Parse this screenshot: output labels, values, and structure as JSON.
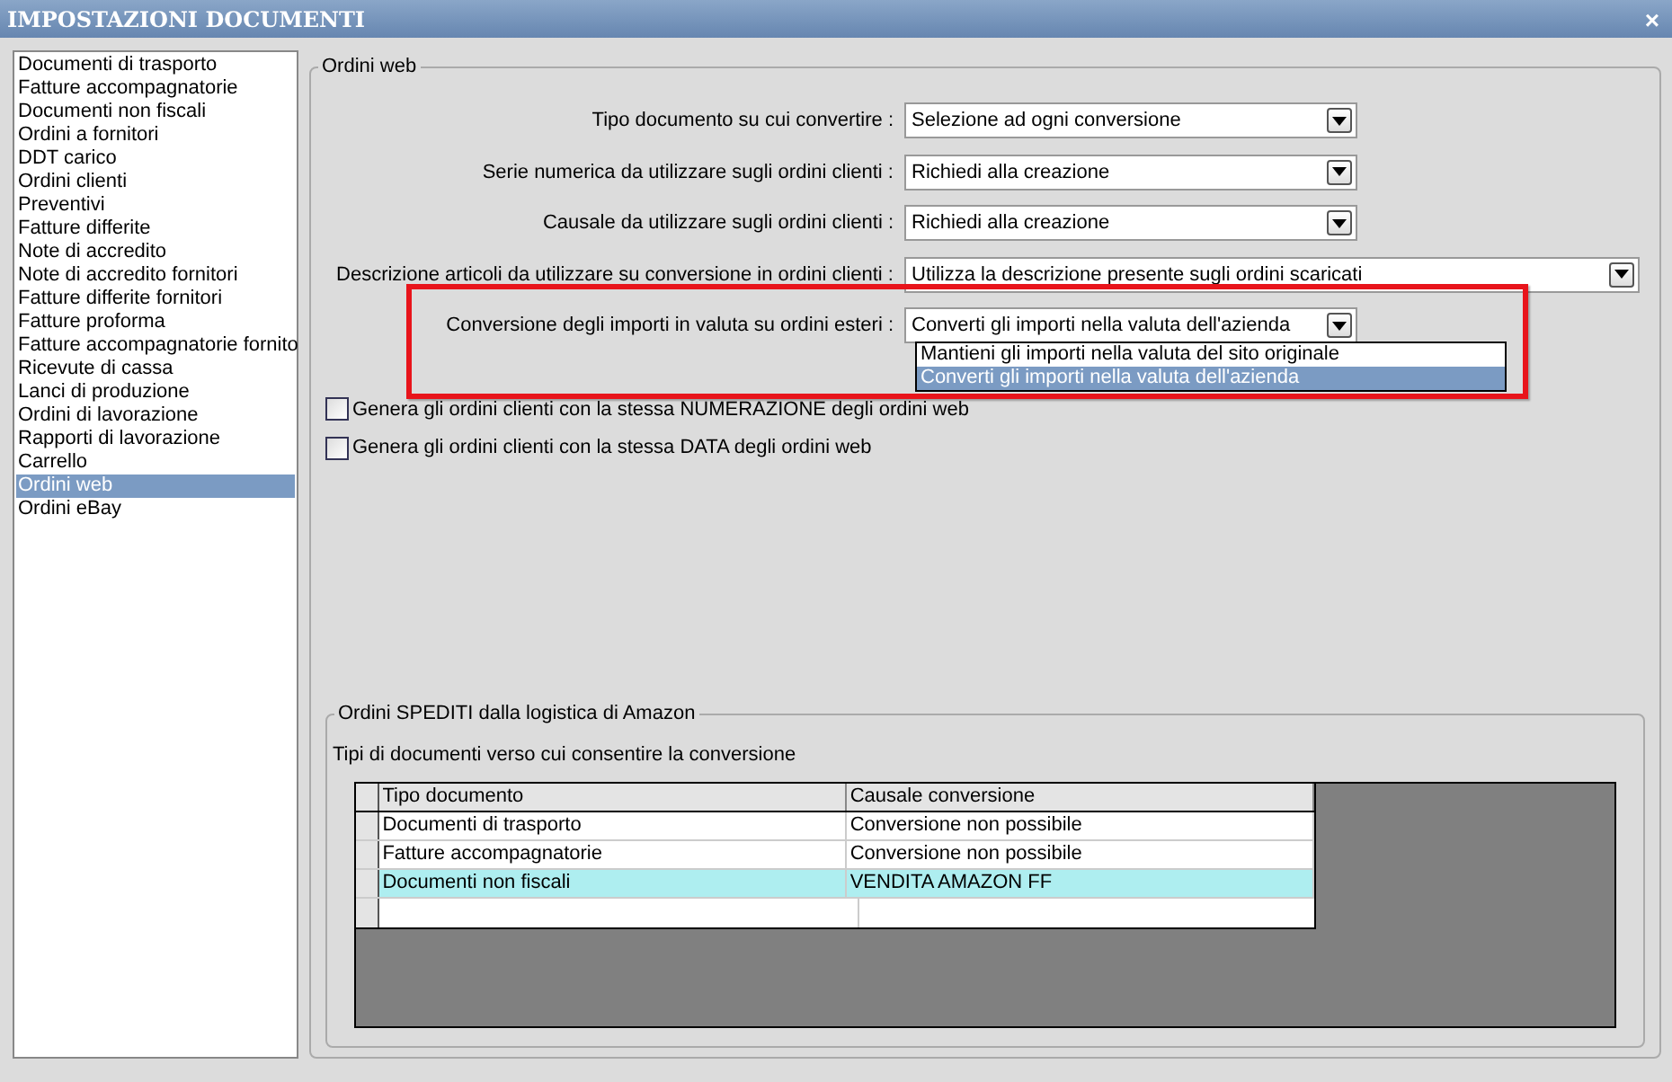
{
  "window": {
    "title": "IMPOSTAZIONI DOCUMENTI",
    "close": "×"
  },
  "sidebar": {
    "items": [
      {
        "label": "Documenti di trasporto",
        "selected": false
      },
      {
        "label": "Fatture accompagnatorie",
        "selected": false
      },
      {
        "label": "Documenti non fiscali",
        "selected": false
      },
      {
        "label": "Ordini a fornitori",
        "selected": false
      },
      {
        "label": "DDT carico",
        "selected": false
      },
      {
        "label": "Ordini clienti",
        "selected": false
      },
      {
        "label": "Preventivi",
        "selected": false
      },
      {
        "label": "Fatture differite",
        "selected": false
      },
      {
        "label": "Note di accredito",
        "selected": false
      },
      {
        "label": "Note di accredito fornitori",
        "selected": false
      },
      {
        "label": "Fatture differite fornitori",
        "selected": false
      },
      {
        "label": "Fatture proforma",
        "selected": false
      },
      {
        "label": "Fatture accompagnatorie fornito",
        "selected": false
      },
      {
        "label": "Ricevute di cassa",
        "selected": false
      },
      {
        "label": "Lanci di produzione",
        "selected": false
      },
      {
        "label": "Ordini di lavorazione",
        "selected": false
      },
      {
        "label": "Rapporti di lavorazione",
        "selected": false
      },
      {
        "label": "Carrello",
        "selected": false
      },
      {
        "label": "Ordini web",
        "selected": true
      },
      {
        "label": "Ordini eBay",
        "selected": false
      }
    ]
  },
  "ordini_web": {
    "title": "Ordini web",
    "fields": [
      {
        "label": "Tipo documento su cui convertire :",
        "value": "Selezione ad ogni conversione",
        "wide": false
      },
      {
        "label": "Serie numerica da utilizzare sugli ordini clienti :",
        "value": "Richiedi alla creazione",
        "wide": false
      },
      {
        "label": "Causale da utilizzare sugli ordini clienti :",
        "value": "Richiedi alla creazione",
        "wide": false
      },
      {
        "label": "Descrizione articoli da utilizzare su conversione in ordini clienti :",
        "value": "Utilizza la descrizione presente sugli ordini scaricati",
        "wide": true
      },
      {
        "label": "Conversione degli importi in valuta su ordini esteri :",
        "value": "Converti gli importi nella valuta dell'azienda",
        "wide": false,
        "expanded": true,
        "options": [
          {
            "label": "Mantieni gli importi nella valuta del sito originale",
            "selected": false
          },
          {
            "label": "Converti gli importi nella valuta dell'azienda",
            "selected": true
          }
        ]
      }
    ],
    "checkboxes": [
      {
        "label": "Genera gli ordini clienti con la stessa NUMERAZIONE degli ordini web",
        "checked": false
      },
      {
        "label": "Genera gli ordini clienti con la stessa DATA degli ordini web",
        "checked": false
      }
    ]
  },
  "amazon": {
    "title": "Ordini SPEDITI dalla logistica di Amazon",
    "caption": "Tipi di documenti verso cui consentire la conversione",
    "table": {
      "columns": [
        "Tipo documento",
        "Causale conversione"
      ],
      "rows": [
        {
          "cells": [
            "Documenti di trasporto",
            "Conversione non possibile"
          ],
          "selected": false
        },
        {
          "cells": [
            "Fatture accompagnatorie",
            "Conversione non possibile"
          ],
          "selected": false
        },
        {
          "cells": [
            "Documenti non fiscali",
            "VENDITA AMAZON FF"
          ],
          "selected": true
        }
      ]
    }
  }
}
